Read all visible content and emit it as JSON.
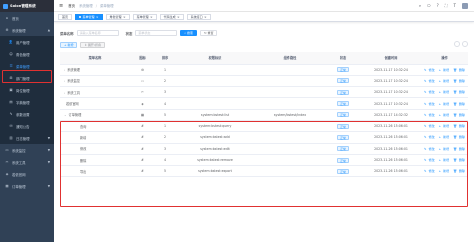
{
  "app": {
    "logo_text": "Solon管理系统"
  },
  "sidebar": {
    "items": [
      {
        "icon": "home-icon",
        "label": "首页",
        "glyph": "⌂"
      },
      {
        "icon": "gear-icon",
        "label": "系统管理",
        "glyph": "⚙",
        "arrow": "▲"
      }
    ],
    "sub_items": [
      {
        "icon": "user-icon",
        "label": "用户管理",
        "glyph": "👤",
        "active": false
      },
      {
        "icon": "peoples-icon",
        "label": "角色管理",
        "glyph": "☺",
        "active": false
      },
      {
        "icon": "tree-table-icon",
        "label": "菜单管理",
        "glyph": "☰",
        "active": true
      },
      {
        "icon": "tree-icon",
        "label": "部门管理",
        "glyph": "⊞",
        "active": false
      },
      {
        "icon": "post-icon",
        "label": "岗位管理",
        "glyph": "▣",
        "active": false
      },
      {
        "icon": "dict-icon",
        "label": "字典管理",
        "glyph": "▤",
        "active": false
      },
      {
        "icon": "edit-icon",
        "label": "参数设置",
        "glyph": "✎",
        "active": false
      },
      {
        "icon": "message-icon",
        "label": "通知公告",
        "glyph": "✉",
        "active": false
      },
      {
        "icon": "log-icon",
        "label": "日志管理",
        "glyph": "▥",
        "active": false,
        "arrow": "▼"
      }
    ],
    "bottom_items": [
      {
        "icon": "monitor-icon",
        "label": "系统监控",
        "glyph": "▭",
        "arrow": "▼"
      },
      {
        "icon": "tool-icon",
        "label": "系统工具",
        "glyph": "✂",
        "arrow": "▼"
      },
      {
        "icon": "guide-icon",
        "label": "若依官网",
        "glyph": "◈"
      },
      {
        "icon": "shopping-icon",
        "label": "订单管理",
        "glyph": "▦",
        "arrow": "▼"
      }
    ]
  },
  "navbar": {
    "breadcrumb": [
      "首页",
      "系统管理",
      "菜单管理"
    ],
    "right_icons": [
      "⌕",
      "⎔",
      "?",
      "⛶",
      "T"
    ]
  },
  "tags": [
    {
      "label": "首页",
      "active": false
    },
    {
      "label": "菜单管理",
      "active": true
    },
    {
      "label": "角色管理",
      "active": false
    },
    {
      "label": "菜单管理",
      "active": false
    },
    {
      "label": "代码生成",
      "active": false
    },
    {
      "label": "系统接口",
      "active": false
    }
  ],
  "search": {
    "name_label": "菜单名称",
    "name_placeholder": "请输入菜单名称",
    "status_label": "状态",
    "status_placeholder": "菜单状态",
    "search_btn": "搜索",
    "reset_btn": "重置"
  },
  "toolbar": {
    "add_btn": "+ 新增",
    "expand_btn": "↕ 展开/折叠"
  },
  "table": {
    "headers": [
      "菜单名称",
      "图标",
      "排序",
      "权限标识",
      "组件路径",
      "状态",
      "创建时间",
      "操作"
    ],
    "rows": [
      {
        "name": "系统管理",
        "caret": "›",
        "icon": "⚙",
        "sort": "1",
        "perm": "",
        "comp": "",
        "status": "正常",
        "time": "2023-11-17 10:32:24",
        "ops": [
          "修改",
          "新增",
          "删除"
        ]
      },
      {
        "name": "系统监控",
        "caret": "›",
        "icon": "▭",
        "sort": "2",
        "perm": "",
        "comp": "",
        "status": "正常",
        "time": "2023-11-17 10:32:24",
        "ops": [
          "修改",
          "新增",
          "删除"
        ]
      },
      {
        "name": "系统工具",
        "caret": "›",
        "icon": "✂",
        "sort": "3",
        "perm": "",
        "comp": "",
        "status": "正常",
        "time": "2023-11-17 10:32:24",
        "ops": [
          "修改",
          "新增",
          "删除"
        ]
      },
      {
        "name": "若依官网",
        "caret": "",
        "icon": "◈",
        "sort": "4",
        "perm": "",
        "comp": "",
        "status": "正常",
        "time": "2023-11-17 10:32:24",
        "ops": [
          "修改",
          "新增",
          "删除"
        ]
      },
      {
        "name": "订单管理",
        "caret": "⌄",
        "icon": "▦",
        "sort": "5",
        "perm": "system:bstest:list",
        "comp": "system/bstest/index",
        "status": "正常",
        "time": "2023-11-17 14:32:32",
        "ops": [
          "修改",
          "新增",
          "删除"
        ]
      },
      {
        "name": "查询",
        "caret": "",
        "icon": "#",
        "sort": "1",
        "perm": "system:bstest:query",
        "comp": "",
        "status": "正常",
        "time": "2023-11-26 15:06:01",
        "ops": [
          "修改",
          "新增",
          "删除"
        ]
      },
      {
        "name": "新增",
        "caret": "",
        "icon": "#",
        "sort": "2",
        "perm": "system:bstest:add",
        "comp": "",
        "status": "正常",
        "time": "2023-11-26 15:06:01",
        "ops": [
          "修改",
          "新增",
          "删除"
        ]
      },
      {
        "name": "修改",
        "caret": "",
        "icon": "#",
        "sort": "3",
        "perm": "system:bstest:edit",
        "comp": "",
        "status": "正常",
        "time": "2023-11-26 15:06:01",
        "ops": [
          "修改",
          "新增",
          "删除"
        ]
      },
      {
        "name": "删除",
        "caret": "",
        "icon": "#",
        "sort": "4",
        "perm": "system:bstest:remove",
        "comp": "",
        "status": "正常",
        "time": "2023-11-26 15:06:01",
        "ops": [
          "修改",
          "新增",
          "删除"
        ]
      },
      {
        "name": "导出",
        "caret": "",
        "icon": "#",
        "sort": "5",
        "perm": "system:bstest:export",
        "comp": "",
        "status": "正常",
        "time": "2023-11-26 15:06:01",
        "ops": [
          "修改",
          "新增",
          "删除"
        ]
      }
    ]
  },
  "colors": {
    "sidebar_bg": "#304156",
    "primary": "#1890ff",
    "highlight": "#e03131"
  }
}
